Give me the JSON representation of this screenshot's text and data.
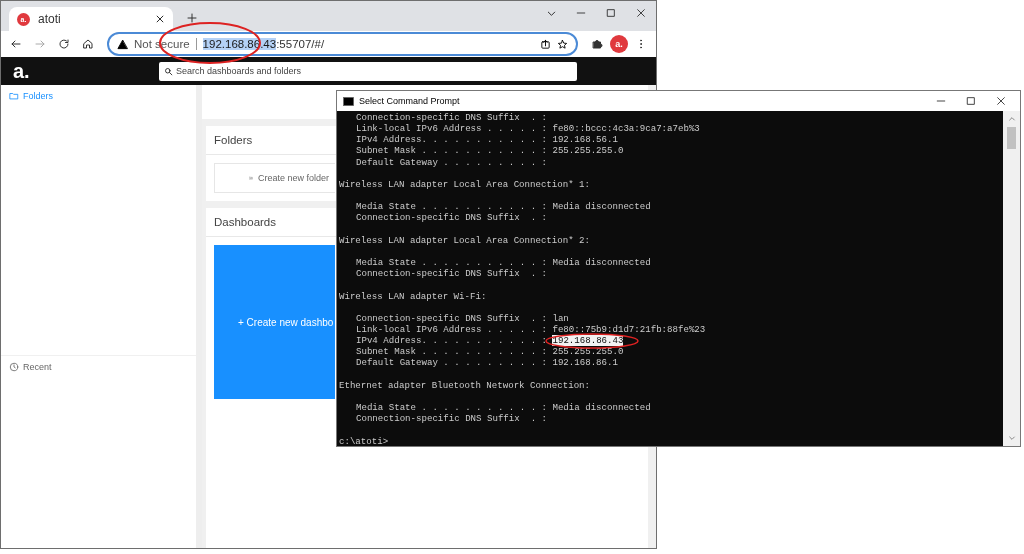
{
  "browser": {
    "tab": {
      "favicon_text": "a.",
      "title": "atoti"
    },
    "address_bar": {
      "security": "Not secure",
      "url_selected": "192.168.86.43",
      "url_rest": ":55707/#/"
    },
    "profile_text": "a.",
    "app": {
      "logo": "a.",
      "search": {
        "placeholder": "Search dashboards and folders"
      },
      "sidebar": {
        "items": [
          {
            "label": "Folders",
            "selected": true
          }
        ],
        "recent": {
          "label": "Recent"
        }
      },
      "folders_card": {
        "title": "Folders",
        "action": "Create new folder"
      },
      "dashboards_card": {
        "title": "Dashboards",
        "action": "+ Create new dashbo"
      }
    }
  },
  "command_prompt": {
    "title": "Select Command Prompt",
    "sections": [
      {
        "lines": [
          {
            "text": "Connection-specific DNS Suffix  . :"
          },
          {
            "text": "Link-local IPv6 Address . . . . . : fe80::bccc:4c3a:9ca7:a7eb%3"
          },
          {
            "text": "IPv4 Address. . . . . . . . . . . : 192.168.56.1"
          },
          {
            "text": "Subnet Mask . . . . . . . . . . . : 255.255.255.0"
          },
          {
            "text": "Default Gateway . . . . . . . . . :"
          }
        ]
      },
      {
        "heading": "Wireless LAN adapter Local Area Connection* 1:",
        "lines": [
          {
            "text": "Media State . . . . . . . . . . . : Media disconnected"
          },
          {
            "text": "Connection-specific DNS Suffix  . :"
          }
        ]
      },
      {
        "heading": "Wireless LAN adapter Local Area Connection* 2:",
        "lines": [
          {
            "text": "Media State . . . . . . . . . . . : Media disconnected"
          },
          {
            "text": "Connection-specific DNS Suffix  . :"
          }
        ]
      },
      {
        "heading": "Wireless LAN adapter Wi-Fi:",
        "lines": [
          {
            "text": "Connection-specific DNS Suffix  . : lan"
          },
          {
            "text": "Link-local IPv6 Address . . . . . : fe80::75b9:d1d7:21fb:88fe%23"
          },
          {
            "text": "IPv4 Address. . . . . . . . . . . :",
            "selection": "192.168.86.43"
          },
          {
            "text": "Subnet Mask . . . . . . . . . . . : 255.255.255.0"
          },
          {
            "text": "Default Gateway . . . . . . . . . : 192.168.86.1"
          }
        ]
      },
      {
        "heading": "Ethernet adapter Bluetooth Network Connection:",
        "lines": [
          {
            "text": "Media State . . . . . . . . . . . : Media disconnected"
          },
          {
            "text": "Connection-specific DNS Suffix  . :"
          }
        ]
      }
    ],
    "prompt": "c:\\atoti>"
  }
}
